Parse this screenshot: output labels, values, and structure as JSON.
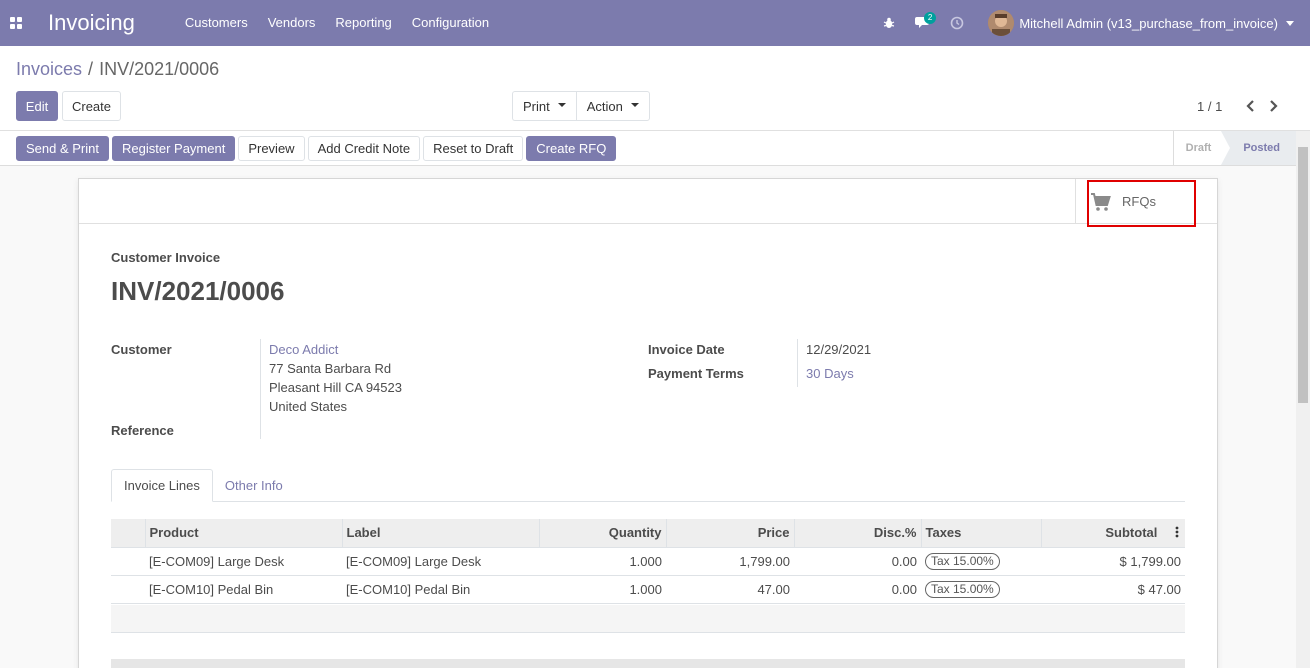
{
  "navbar": {
    "app_name": "Invoicing",
    "menu": [
      "Customers",
      "Vendors",
      "Reporting",
      "Configuration"
    ],
    "messages_count": "2",
    "user_name": "Mitchell Admin (v13_purchase_from_invoice)"
  },
  "breadcrumb": {
    "parent": "Invoices",
    "separator": "/",
    "current": "INV/2021/0006"
  },
  "toolbar": {
    "edit_label": "Edit",
    "create_label": "Create",
    "print_label": "Print",
    "action_label": "Action",
    "pager": "1 / 1"
  },
  "status_buttons": [
    "Send & Print",
    "Register Payment",
    "Preview",
    "Add Credit Note",
    "Reset to Draft",
    "Create RFQ"
  ],
  "stages": {
    "draft": "Draft",
    "posted": "Posted",
    "active": "Posted"
  },
  "smart_button": {
    "label": "RFQs",
    "icon": "shopping-cart-icon"
  },
  "invoice": {
    "type": "Customer Invoice",
    "name": "INV/2021/0006",
    "customer_label": "Customer",
    "customer_name": "Deco Addict",
    "address_line1": "77 Santa Barbara Rd",
    "address_line2": "Pleasant Hill CA 94523",
    "address_line3": "United States",
    "reference_label": "Reference",
    "invoice_date_label": "Invoice Date",
    "invoice_date": "12/29/2021",
    "payment_terms_label": "Payment Terms",
    "payment_terms": "30 Days"
  },
  "tabs": [
    "Invoice Lines",
    "Other Info"
  ],
  "lines": {
    "headers": [
      "Product",
      "Label",
      "Quantity",
      "Price",
      "Disc.%",
      "Taxes",
      "Subtotal"
    ],
    "rows": [
      {
        "product": "[E-COM09] Large Desk",
        "label": "[E-COM09] Large Desk",
        "quantity": "1.000",
        "price": "1,799.00",
        "discount": "0.00",
        "taxes": "Tax 15.00%",
        "subtotal": "$ 1,799.00"
      },
      {
        "product": "[E-COM10] Pedal Bin",
        "label": "[E-COM10] Pedal Bin",
        "quantity": "1.000",
        "price": "47.00",
        "discount": "0.00",
        "taxes": "Tax 15.00%",
        "subtotal": "$ 47.00"
      }
    ]
  },
  "colors": {
    "brand": "#7c7bad",
    "highlight": "#e00000"
  }
}
